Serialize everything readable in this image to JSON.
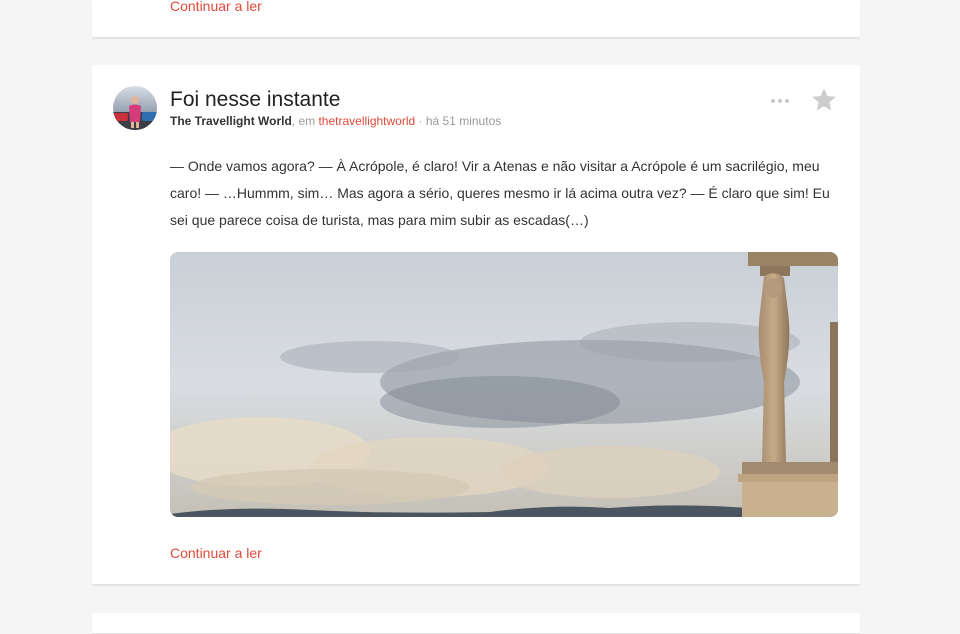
{
  "top_card": {
    "continue_label": "Continuar a ler"
  },
  "post": {
    "title": "Foi nesse instante",
    "author": "The Travellight World",
    "in_text": ", em ",
    "blog": "thetravellightworld",
    "separator": " · ",
    "time": "há 51 minutos",
    "excerpt": "— Onde vamos agora? — À Acrópole, é claro! Vir a Atenas e não visitar a Acrópole é um sacrilégio, meu caro! — …Hummm, sim… Mas agora a sério, queres mesmo ir lá acima outra vez? — É claro que sim! Eu sei que parece coisa de turista, mas para mim subir as escadas(…)",
    "continue_label": "Continuar a ler",
    "more_icon": "more-dots-icon",
    "star_icon": "star-icon"
  },
  "colors": {
    "accent": "#dd4b39",
    "background": "#f5f5f5",
    "card": "#ffffff",
    "title": "#222222",
    "muted": "#999999",
    "icon": "#cccccc"
  }
}
